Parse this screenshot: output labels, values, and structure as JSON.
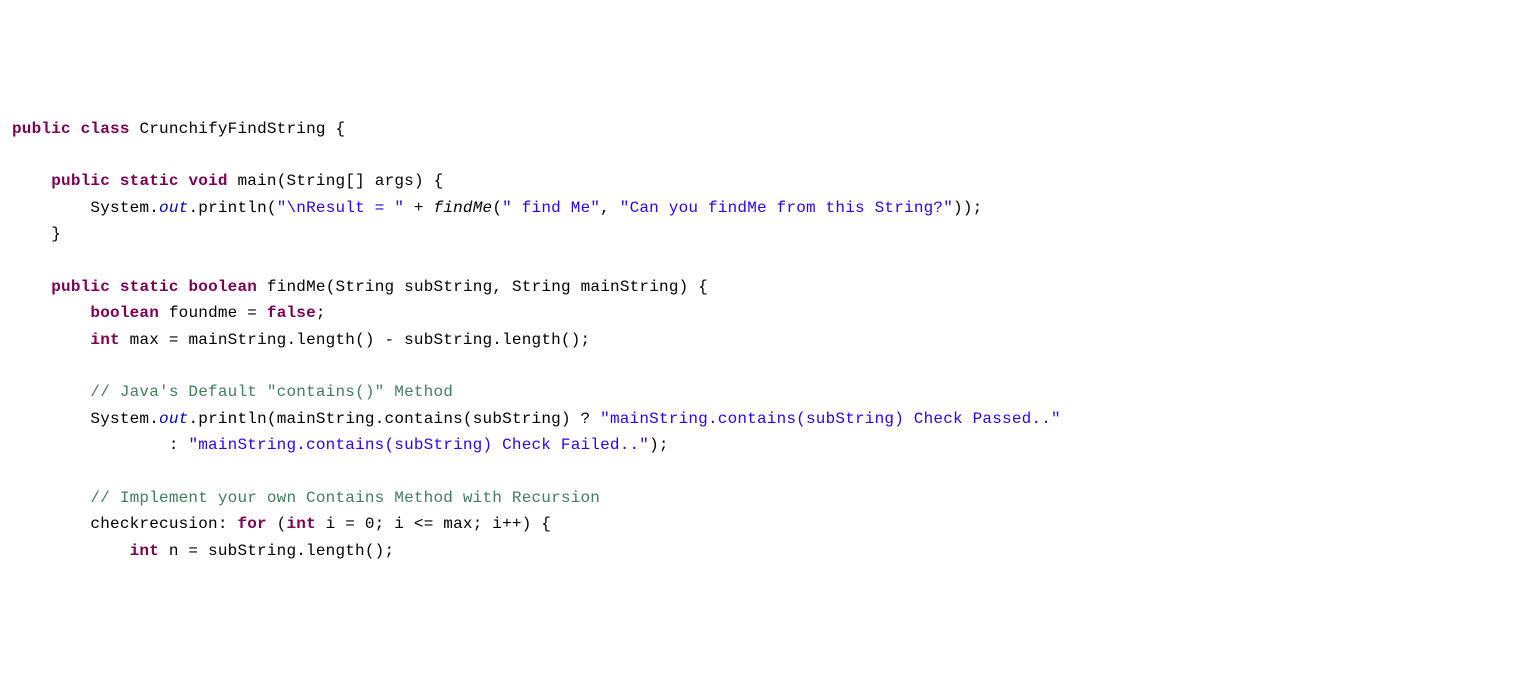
{
  "code": {
    "line1": {
      "kw_public": "public",
      "kw_class": "class",
      "classname": "CrunchifyFindString",
      "brace": "{"
    },
    "line3": {
      "kw_public": "public",
      "kw_static": "static",
      "kw_void": "void",
      "method": "main",
      "lp": "(",
      "ptype": "String[]",
      "pname": "args",
      "rp": ")",
      "brace": "{"
    },
    "line4": {
      "sys": "System",
      "dot1": ".",
      "out": "out",
      "dot2": ".",
      "println": "println",
      "lp": "(",
      "str1": "\"\\nResult = \"",
      "plus": " + ",
      "findMe": "findMe",
      "lp2": "(",
      "str2": "\" find Me\"",
      "comma": ", ",
      "str3": "\"Can you findMe from this String?\"",
      "rp2": "));"
    },
    "line5": {
      "brace": "}"
    },
    "line7": {
      "kw_public": "public",
      "kw_static": "static",
      "kw_boolean": "boolean",
      "method": "findMe",
      "lp": "(",
      "ptype1": "String",
      "pname1": "subString",
      "comma": ", ",
      "ptype2": "String",
      "pname2": "mainString",
      "rp": ")",
      "brace": "{"
    },
    "line8": {
      "kw_boolean": "boolean",
      "var": "foundme",
      "eq": " = ",
      "val": "false",
      "semi": ";"
    },
    "line9": {
      "kw_int": "int",
      "var": "max",
      "eq": " = ",
      "expr1": "mainString.length()",
      "minus": " - ",
      "expr2": "subString.length();"
    },
    "line11": {
      "comment": "// Java's Default \"contains()\" Method"
    },
    "line12": {
      "sys": "System",
      "dot1": ".",
      "out": "out",
      "dot2": ".",
      "println": "println",
      "lp": "(",
      "expr": "mainString.contains(subString) ? ",
      "str1": "\"mainString.contains(subString) Check Passed..\""
    },
    "line13": {
      "colon": ": ",
      "str2": "\"mainString.contains(subString) Check Failed..\"",
      "rp": ");"
    },
    "line15": {
      "comment": "// Implement your own Contains Method with Recursion"
    },
    "line16": {
      "label": "checkrecusion: ",
      "kw_for": "for",
      "lp": " (",
      "kw_int": "int",
      "init": " i = 0; i <= max; i++) {"
    },
    "line17": {
      "kw_int": "int",
      "rest": " n = subString.length();"
    }
  }
}
